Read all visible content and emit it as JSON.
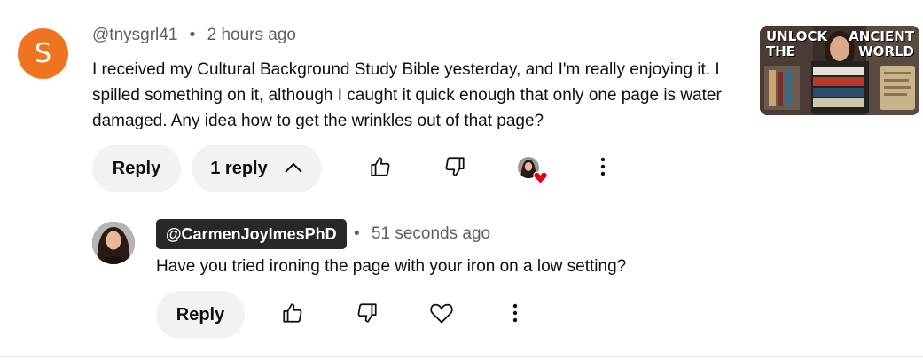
{
  "comment": {
    "avatar_letter": "S",
    "avatar_color": "#f0741f",
    "author": "@tnysgrl41",
    "separator": "•",
    "time": "2 hours ago",
    "text": "I received my Cultural Background Study Bible yesterday, and I'm really enjoying it. I spilled something on it, although I caught it quick enough that only one page is water damaged. Any idea how to get the wrinkles out of that page?",
    "reply_label": "Reply",
    "replies_label": "1 reply",
    "like_icon": "thumbs-up-icon",
    "dislike_icon": "thumbs-down-icon",
    "creator_heart_icon": "creator-heart-icon",
    "more_icon": "more-vert-icon"
  },
  "thumbnail": {
    "text_left_1": "UNLOCK",
    "text_left_2": "THE",
    "text_right_1": "ANCIENT",
    "text_right_2": "WORLD"
  },
  "reply": {
    "author": "@CarmenJoyImesPhD",
    "separator": "•",
    "time": "51 seconds ago",
    "text": "Have you tried ironing the page with your iron on a low setting?",
    "reply_label": "Reply",
    "like_icon": "thumbs-up-icon",
    "dislike_icon": "thumbs-down-icon",
    "heart_icon": "heart-outline-icon",
    "more_icon": "more-vert-icon"
  },
  "colors": {
    "heart": "#e3001b",
    "chip_bg": "#282828"
  }
}
